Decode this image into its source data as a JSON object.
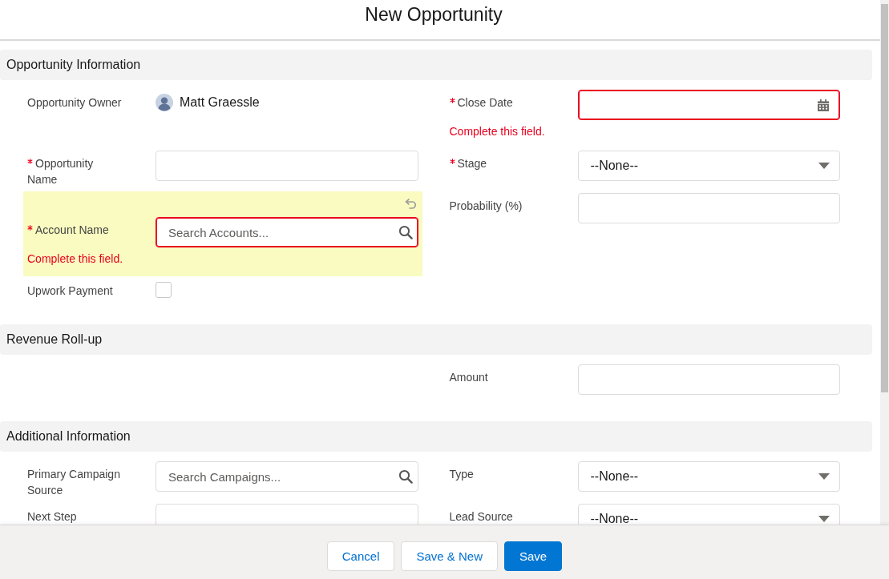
{
  "window": {
    "title": "New Opportunity"
  },
  "sections": [
    {
      "title": "Opportunity Information",
      "left": [
        {
          "kind": "owner",
          "label": "Opportunity Owner",
          "value": "Matt Graessle",
          "required": false,
          "invalid": false,
          "highlighted": false
        },
        {
          "kind": "text",
          "label": "Opportunity Name",
          "required": true,
          "invalid": false,
          "highlighted": false
        },
        {
          "kind": "lookup",
          "label": "Account Name",
          "placeholder": "Search Accounts...",
          "required": true,
          "invalid": true,
          "error": "Complete this field.",
          "highlighted": true
        },
        {
          "kind": "checkbox",
          "label": "Upwork Payment",
          "checked": false,
          "required": false,
          "invalid": false,
          "highlighted": false
        }
      ],
      "right": [
        {
          "kind": "date",
          "label": "Close Date",
          "required": true,
          "invalid": true,
          "error": "Complete this field.",
          "highlighted": false
        },
        {
          "kind": "select",
          "label": "Stage",
          "value": "--None--",
          "required": true,
          "invalid": false,
          "highlighted": false
        },
        {
          "kind": "text",
          "label": "Probability (%)",
          "required": false,
          "invalid": false,
          "highlighted": false
        }
      ]
    },
    {
      "title": "Revenue Roll-up",
      "right": [
        {
          "kind": "text",
          "label": "Amount",
          "required": false,
          "invalid": false,
          "highlighted": false
        }
      ]
    },
    {
      "title": "Additional Information",
      "left": [
        {
          "kind": "lookup",
          "label": "Primary Campaign Source",
          "placeholder": "Search Campaigns...",
          "required": false,
          "invalid": false,
          "highlighted": false
        },
        {
          "kind": "text",
          "label": "Next Step",
          "required": false,
          "invalid": false,
          "highlighted": false
        }
      ],
      "right": [
        {
          "kind": "select",
          "label": "Type",
          "value": "--None--",
          "required": false,
          "invalid": false,
          "highlighted": false
        },
        {
          "kind": "select",
          "label": "Lead Source",
          "value": "--None--",
          "required": false,
          "invalid": false,
          "highlighted": false
        }
      ]
    }
  ],
  "footer": {
    "buttons": [
      {
        "label": "Cancel",
        "kind": "neutral"
      },
      {
        "label": "Save & New",
        "kind": "neutral"
      },
      {
        "label": "Save",
        "kind": "brand"
      }
    ]
  }
}
